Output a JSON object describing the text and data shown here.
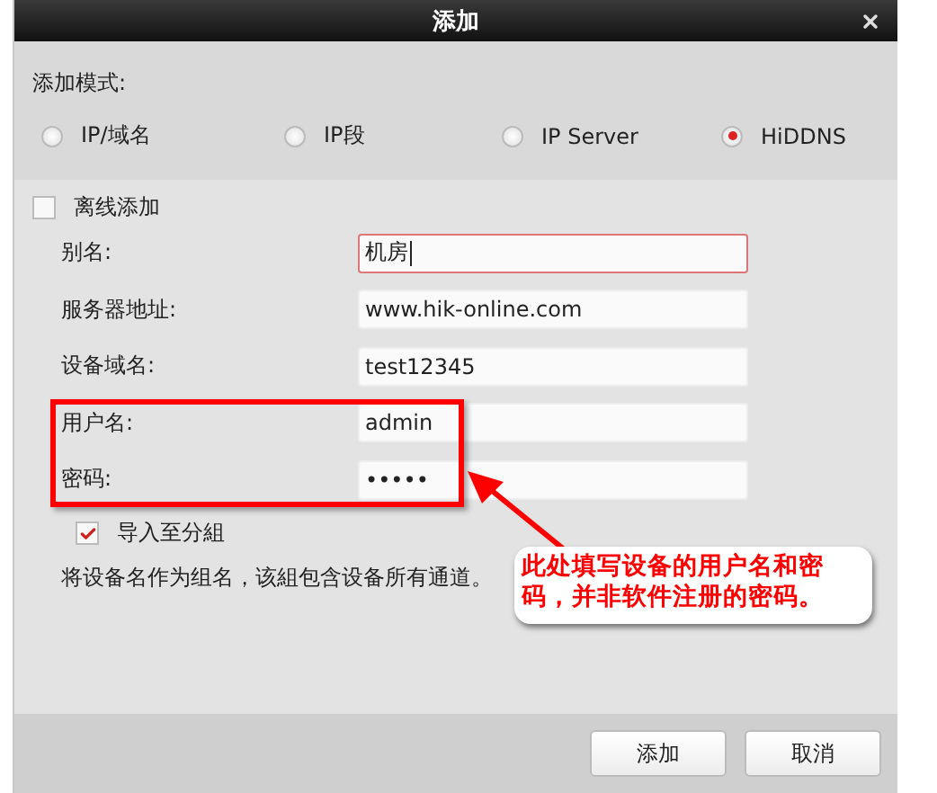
{
  "window": {
    "title": "添加"
  },
  "mode": {
    "label": "添加模式:",
    "options": [
      {
        "label": "IP/域名",
        "selected": false
      },
      {
        "label": "IP段",
        "selected": false
      },
      {
        "label": "IP Server",
        "selected": false
      },
      {
        "label": "HiDDNS",
        "selected": true
      }
    ]
  },
  "offline": {
    "label": "离线添加",
    "checked": false
  },
  "fields": [
    {
      "label": "别名:",
      "value": "机房",
      "focused": true
    },
    {
      "label": "服务器地址:",
      "value": "www.hik-online.com",
      "focused": false
    },
    {
      "label": "设备域名:",
      "value": "test12345",
      "focused": false
    },
    {
      "label": "用户名:",
      "value": "admin",
      "focused": false
    },
    {
      "label": "密码:",
      "value": "•••••",
      "focused": false
    }
  ],
  "import_group": {
    "label": "导入至分組",
    "checked": true
  },
  "note": "将设备名作为组名，该組包含设备所有通道。",
  "annotation": {
    "text": "此处填写设备的用户名和密码，并非软件注册的密码。"
  },
  "buttons": [
    "添加",
    "取消"
  ]
}
